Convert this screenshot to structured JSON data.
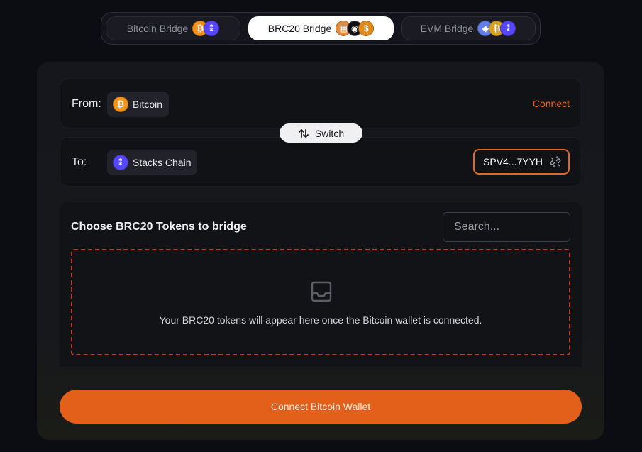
{
  "tabs": [
    {
      "label": "Bitcoin Bridge",
      "active": false,
      "coins": [
        "bitcoin-coin-icon",
        "stacks-coin-icon"
      ]
    },
    {
      "label": "BRC20 Bridge",
      "active": true,
      "coins": [
        "ordi-coin-icon",
        "black-coin-icon",
        "brown-coin-icon"
      ]
    },
    {
      "label": "EVM Bridge",
      "active": false,
      "coins": [
        "ethereum-coin-icon",
        "gold-coin-icon",
        "stacks-coin-icon"
      ]
    }
  ],
  "from": {
    "label": "From:",
    "chain": "Bitcoin",
    "action": "Connect"
  },
  "switch": {
    "label": "Switch"
  },
  "to": {
    "label": "To:",
    "chain": "Stacks Chain",
    "address": "SPV4...7YYH"
  },
  "tokens": {
    "title": "Choose BRC20 Tokens to bridge",
    "search_placeholder": "Search...",
    "empty_message": "Your BRC20 tokens will appear here once the Bitcoin wallet is connected."
  },
  "cta": {
    "label": "Connect Bitcoin Wallet"
  },
  "colors": {
    "accent": "#e2601a",
    "dashed_border": "#c0392b",
    "bitcoin": "#f7931a",
    "stacks": "#5546ff",
    "ethereum": "#627eea"
  }
}
